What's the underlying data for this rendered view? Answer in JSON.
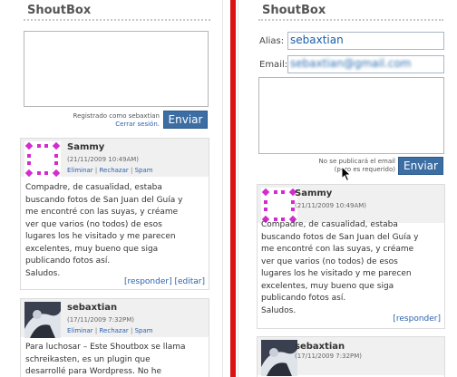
{
  "left": {
    "title": "ShoutBox",
    "logged_in_label": "Registrado como sebaxtian",
    "logout_link": "Cerrar sesión.",
    "send_label": "Enviar",
    "shouts": [
      {
        "author": "Sammy",
        "date": "(21/11/2009 10:49AM)",
        "actions": [
          "Eliminar",
          "Rechazar",
          "Spam"
        ],
        "lines": [
          "Compadre, de casualidad, estaba",
          "buscando fotos de San Juan del Guía y",
          "me encontré con las suyas, y créame",
          "ver que varios (no todos) de esos",
          "lugares los he visitado y me parecen",
          "excelentes, muy bueno que siga",
          "publicando fotos así.",
          "Saludos."
        ],
        "reply_link": "[responder]",
        "edit_link": "[editar]"
      },
      {
        "author": "sebaxtian",
        "date": "(17/11/2009 7:32PM)",
        "actions": [
          "Eliminar",
          "Rechazar",
          "Spam"
        ],
        "lines": [
          "Para luchosar – Este Shoutbox se llama",
          "schreikasten, es un plugin que",
          "desarrollé para Wordpress. No he"
        ]
      }
    ]
  },
  "right": {
    "title": "ShoutBox",
    "alias_label": "Alias:",
    "alias_value": "sebaxtian",
    "email_label": "Email:",
    "email_value": "sebaxtian@gmail.com",
    "email_note_line1": "No se publicará el email",
    "email_note_line2": "(pero es requerido)",
    "send_label": "Enviar",
    "shouts": [
      {
        "author": "Sammy",
        "date": "(21/11/2009 10:49AM)",
        "lines": [
          "Compadre, de casualidad, estaba",
          "buscando fotos de San Juan del Guía y",
          "me encontré con las suyas, y créame",
          "ver que varios (no todos) de esos",
          "lugares los he visitado y me parecen",
          "excelentes, muy bueno que siga",
          "publicando fotos así.",
          "Saludos."
        ],
        "reply_link": "[responder]"
      },
      {
        "author": "sebaxtian",
        "date": "(17/11/2009 7:32PM)"
      }
    ]
  },
  "colors": {
    "divider": "#dd1111",
    "button": "#3c6ea4",
    "link": "#2a62b0",
    "shout_header": "#f0f0f0"
  },
  "icons": [
    "identicon-magenta-avatar",
    "dark-avatar",
    "mouse-cursor"
  ]
}
